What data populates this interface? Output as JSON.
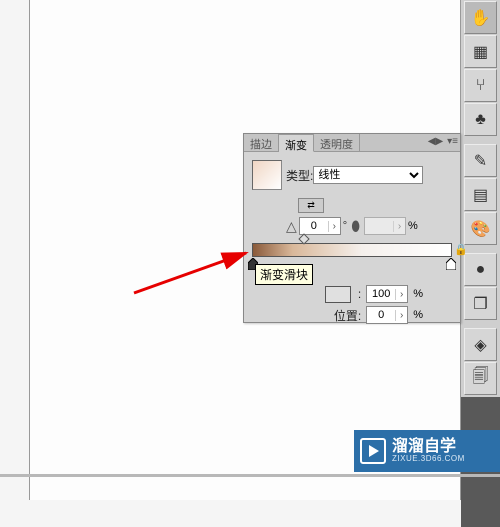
{
  "tabs": {
    "stroke": "描边",
    "gradient": "渐变",
    "transparency": "透明度"
  },
  "type_label": "类型:",
  "type_value": "线性",
  "angle": "0",
  "aspect_ratio_field": "",
  "aspect_pct": "%",
  "opacity_value": "100",
  "opacity_pct": "%",
  "position_label": "位置:",
  "position_value": "0",
  "position_pct": "%",
  "tooltip": "渐变滑块",
  "tools": {
    "grab": "✋",
    "grid": "▦",
    "branch": "⑂",
    "clubs": "♣",
    "eyedrop": "✎",
    "gradient": "▤",
    "palette": "🎨",
    "circle": "●",
    "overlap": "❐",
    "layers": "◈",
    "copy": "🗐"
  },
  "watermark": {
    "title": "溜溜自学",
    "sub": "ZIXUE.3D66.COM"
  }
}
